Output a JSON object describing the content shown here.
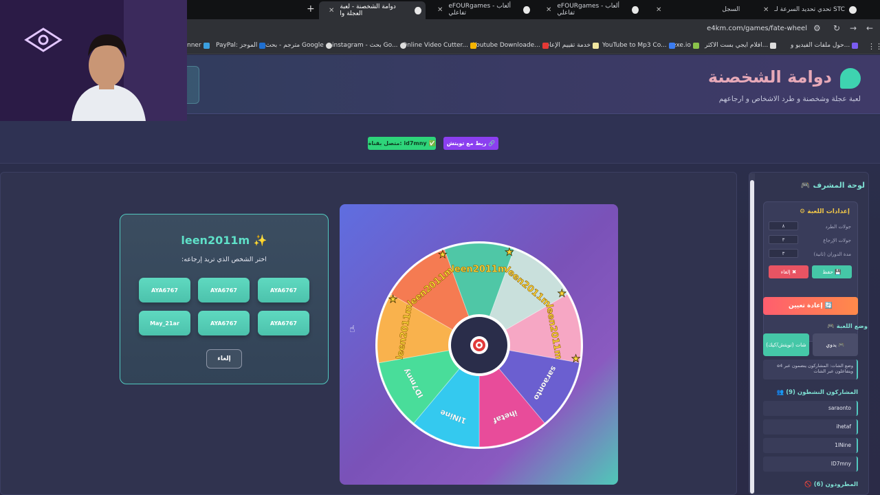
{
  "browser": {
    "tabs": [
      {
        "label": "تحدي تحديد السرعة لـ STC"
      },
      {
        "label": "السجل"
      },
      {
        "label": "eFOURgames - ألعاب تفاعلي"
      },
      {
        "label": "eFOURgames - ألعاب تفاعلي"
      },
      {
        "label": "دوامة الشخصنة - لعبة العجلة وا"
      }
    ],
    "url": "e4km.com/games/fate-wheel",
    "bookmarks": [
      "حول ملفات الفيديو و...",
      "افلام ايجي بست الاكثر...",
      "exe.io",
      "YouTube to Mp3 Co...",
      "خدمة تقييم الإعاقة",
      "Youtube Downloade...",
      "Online Video Cutter...",
      "instagram - بحث Go...",
      "مترجم - بحث Google",
      "PayPal: الموجز",
      "nner"
    ]
  },
  "header": {
    "title": "دوامة الشخصنة",
    "subtitle": "لعبة عجلة وشخصنة و طرد الاشخاص و ارجاعهم"
  },
  "connection": {
    "connected_label": "متصل بقناة: id7mny",
    "twitch_label": "ربط مع تويتش"
  },
  "selection": {
    "name": "leen2011m",
    "prompt": "اختر الشخص الذي تريد إرجاعه:",
    "choices": [
      "AYA6767",
      "AYA6767",
      "AYA6767",
      "AYA6767",
      "AYA6767",
      "May_21ar"
    ],
    "cancel_label": "إلغاء"
  },
  "wheel": {
    "segments": [
      {
        "label": "leen2011m",
        "color": "#4fc7a6"
      },
      {
        "label": "leen2011m",
        "color": "#c9e0dc"
      },
      {
        "label": "leen2011m",
        "color": "#f6a7c4"
      },
      {
        "label": "saraonto",
        "color": "#6b5fd0"
      },
      {
        "label": "ihetaf",
        "color": "#e84c9a"
      },
      {
        "label": "1lNine",
        "color": "#34c9ef"
      },
      {
        "label": "ID7mny",
        "color": "#49dd9a"
      },
      {
        "label": "leen2011m",
        "color": "#f9b24d"
      },
      {
        "label": "leen2011m",
        "color": "#f57b52"
      }
    ],
    "center_icon": "target-icon"
  },
  "admin": {
    "title": "لوحة المشرف",
    "settings_title": "إعدادات اللعبة",
    "settings": [
      {
        "label": "جولات الطرد",
        "value": "٨"
      },
      {
        "label": "جولات الإرجاع",
        "value": "٣"
      },
      {
        "label": "مدة الدوران (ثانية)",
        "value": "٣"
      }
    ],
    "save_label": "حفظ",
    "cancel_label": "إلغاء",
    "reset_label": "إعادة تعيين",
    "mode_title": "وضع اللعبة",
    "mode_manual": "يدوي",
    "mode_chat": "شات (تويتش/كيك)",
    "mode_desc": "وضع الشات: المشاركون ينضمون عبر e4 ويتفاعلون عبر الشات",
    "participants_title": "المشاركون النشطون (9)",
    "participants": [
      "saraonto",
      "ihetaf",
      "1lNine",
      "ID7mny"
    ],
    "kicked_title": "المطرودون (6)"
  }
}
